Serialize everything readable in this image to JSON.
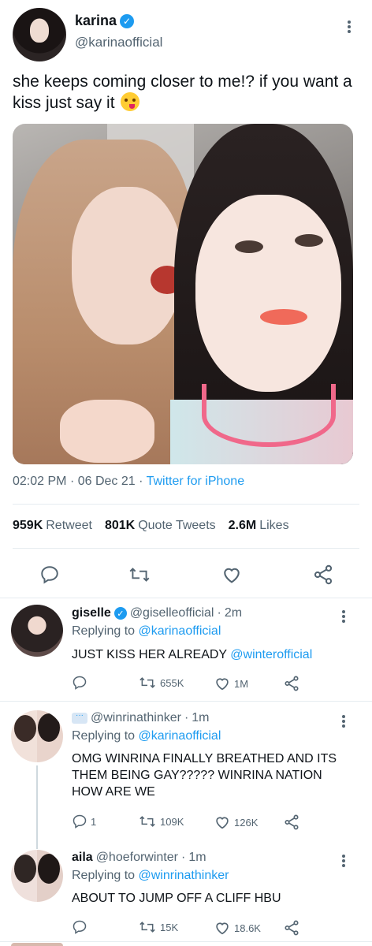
{
  "main_tweet": {
    "display_name": "karina",
    "handle": "@karinaofficial",
    "text": "she keeps coming closer to me!? if you want a kiss just say it",
    "emoji": "savoring-food-emoji",
    "time": "02:02 PM",
    "date": "06 Dec 21",
    "separator": "·",
    "source": "Twitter for iPhone",
    "stats": {
      "retweets_count": "959K",
      "retweets_label": "Retweet",
      "quotes_count": "801K",
      "quotes_label": "Quote Tweets",
      "likes_count": "2.6M",
      "likes_label": "Likes"
    }
  },
  "replies": [
    {
      "display_name": "giselle",
      "verified": true,
      "handle": "@giselleofficial",
      "time": "2m",
      "replying_label": "Replying to",
      "replying_to": "@karinaofficial",
      "text": "JUST KISS HER ALREADY",
      "mention": "@winterofficial",
      "reply_count": "",
      "retweet_count": "655K",
      "like_count": "1M"
    },
    {
      "display_name": "",
      "handle": "@winrinathinker",
      "time": "1m",
      "replying_label": "Replying to",
      "replying_to": "@karinaofficial",
      "text": "OMG WINRINA FINALLY BREATHED AND ITS THEM BEING GAY?????  WINRINA NATION HOW ARE WE",
      "reply_count": "1",
      "retweet_count": "109K",
      "like_count": "126K"
    },
    {
      "display_name": "aila",
      "handle": "@hoeforwinter",
      "time": "1m",
      "replying_label": "Replying to",
      "replying_to": "@winrinathinker",
      "text": "ABOUT TO JUMP OFF A CLIFF HBU",
      "reply_count": "",
      "retweet_count": "15K",
      "like_count": "18.6K"
    }
  ],
  "colors": {
    "accent": "#1d9bf0",
    "text": "#0f1419",
    "secondary": "#536471",
    "divider": "#e6ecf0"
  }
}
